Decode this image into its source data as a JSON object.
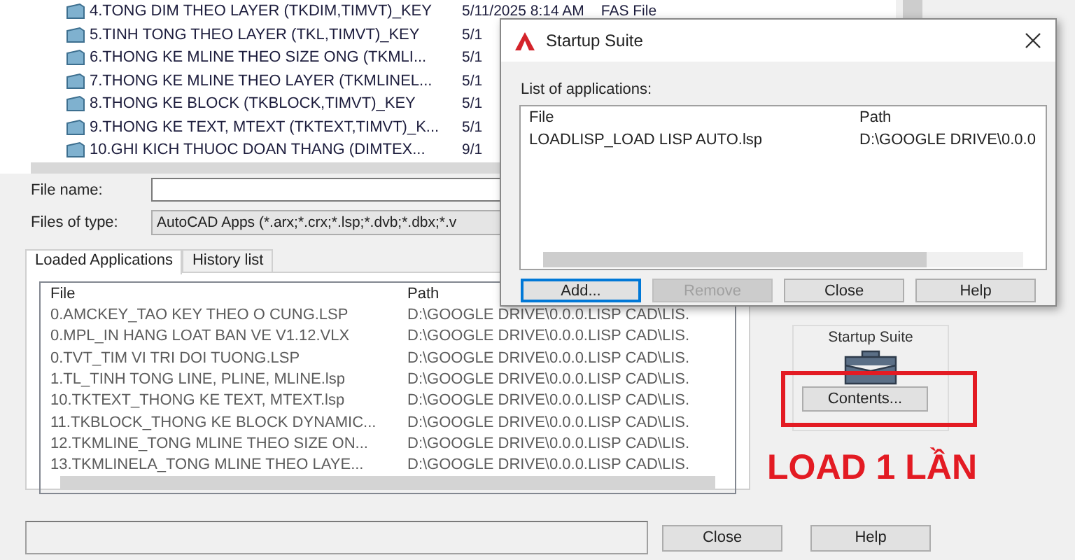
{
  "file_list": {
    "rows": [
      {
        "name": "4.TONG DIM THEO LAYER (TKDIM,TIMVT)_KEY",
        "date": "5/11/2025 8:14 AM",
        "type": "FAS File"
      },
      {
        "name": "5.TINH TONG THEO LAYER (TKL,TIMVT)_KEY",
        "date": "5/1"
      },
      {
        "name": "6.THONG KE MLINE THEO SIZE ONG (TKMLI...",
        "date": "5/1"
      },
      {
        "name": "7.THONG KE MLINE THEO LAYER (TKMLINEL...",
        "date": "5/1"
      },
      {
        "name": "8.THONG KE BLOCK (TKBLOCK,TIMVT)_KEY",
        "date": "5/1"
      },
      {
        "name": "9.THONG KE TEXT, MTEXT (TKTEXT,TIMVT)_K...",
        "date": "5/1"
      },
      {
        "name": "10.GHI KICH THUOC DOAN THANG (DIMTEX...",
        "date": "9/1"
      }
    ]
  },
  "file_name": {
    "label": "File name:"
  },
  "files_of_type": {
    "label": "Files of type:",
    "value": "AutoCAD Apps (*.arx;*.crx;*.lsp;*.dvb;*.dbx;*.v"
  },
  "tabs": [
    {
      "label": "Loaded Applications",
      "selected": true
    },
    {
      "label": "History list",
      "selected": false
    }
  ],
  "loaded_applications": {
    "columns": [
      "File",
      "Path"
    ],
    "rows": [
      {
        "file": "0.AMCKEY_TAO KEY THEO O CUNG.LSP",
        "path": "D:\\GOOGLE DRIVE\\0.0.0.LISP CAD\\LIS."
      },
      {
        "file": "0.MPL_IN HANG LOAT BAN VE V1.12.VLX",
        "path": "D:\\GOOGLE DRIVE\\0.0.0.LISP CAD\\LIS."
      },
      {
        "file": "0.TVT_TIM VI TRI DOI TUONG.LSP",
        "path": "D:\\GOOGLE DRIVE\\0.0.0.LISP CAD\\LIS."
      },
      {
        "file": "1.TL_TINH TONG LINE, PLINE, MLINE.lsp",
        "path": "D:\\GOOGLE DRIVE\\0.0.0.LISP CAD\\LIS."
      },
      {
        "file": "10.TKTEXT_THONG KE TEXT, MTEXT.lsp",
        "path": "D:\\GOOGLE DRIVE\\0.0.0.LISP CAD\\LIS."
      },
      {
        "file": "11.TKBLOCK_THONG KE BLOCK DYNAMIC...",
        "path": "D:\\GOOGLE DRIVE\\0.0.0.LISP CAD\\LIS."
      },
      {
        "file": "12.TKMLINE_TONG MLINE THEO SIZE ON...",
        "path": "D:\\GOOGLE DRIVE\\0.0.0.LISP CAD\\LIS."
      },
      {
        "file": "13.TKMLINELA_TONG MLINE THEO LAYE...",
        "path": "D:\\GOOGLE DRIVE\\0.0.0.LISP CAD\\LIS."
      }
    ]
  },
  "startup_suite": {
    "title": "Startup Suite",
    "button": "Contents..."
  },
  "annotation": {
    "text": "LOAD 1 LẦN"
  },
  "buttons": [
    "Close",
    "Help"
  ],
  "dialog": {
    "title": "Startup Suite",
    "list_label": "List of applications:",
    "columns": [
      "File",
      "Path"
    ],
    "rows": [
      {
        "file": "LOADLISP_LOAD LISP AUTO.lsp",
        "path": "D:\\GOOGLE DRIVE\\0.0.0"
      }
    ],
    "buttons": [
      {
        "label": "Add...",
        "disabled": false,
        "default": true
      },
      {
        "label": "Remove",
        "disabled": true,
        "default": false
      },
      {
        "label": "Close",
        "disabled": false,
        "default": false
      },
      {
        "label": "Help",
        "disabled": false,
        "default": false
      }
    ]
  }
}
